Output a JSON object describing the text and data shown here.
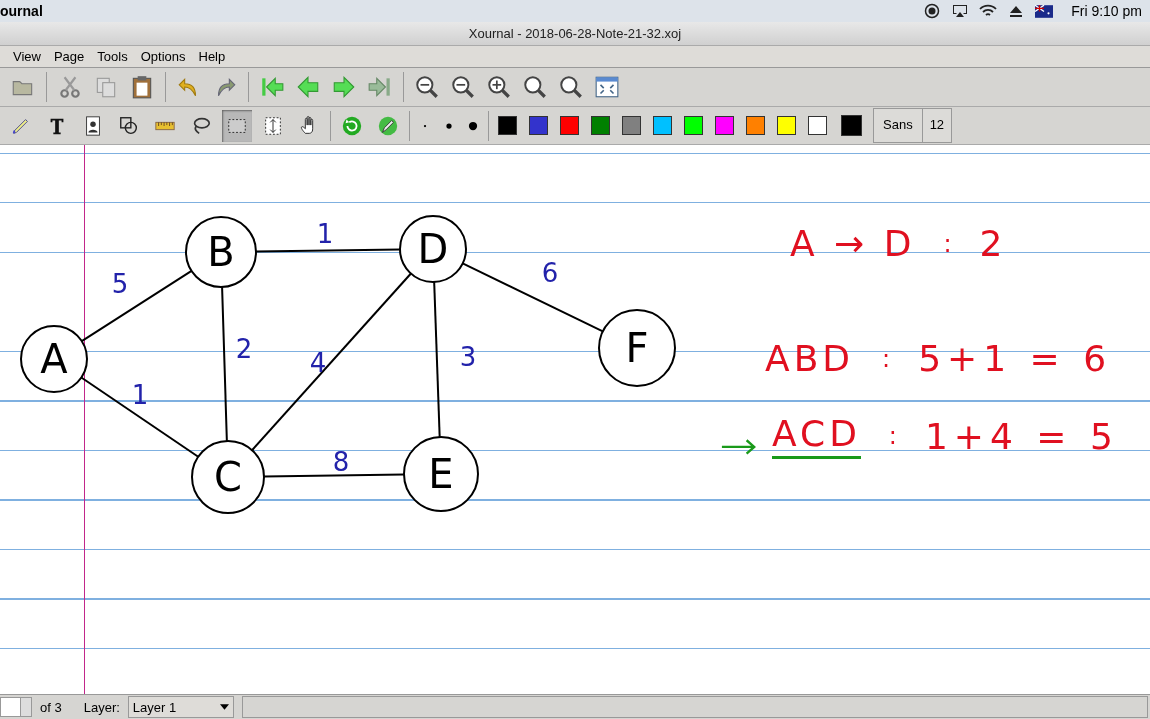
{
  "system_bar": {
    "app_name": "ournal",
    "clock": "Fri 9:10 pm"
  },
  "window": {
    "title": "Xournal - 2018-06-28-Note-21-32.xoj"
  },
  "menu": [
    "View",
    "Page",
    "Tools",
    "Options",
    "Help"
  ],
  "tools": [
    {
      "kind": "pen",
      "selected": false
    },
    {
      "kind": "text",
      "selected": false
    },
    {
      "kind": "image",
      "selected": false
    },
    {
      "kind": "shape",
      "selected": false
    },
    {
      "kind": "ruler",
      "selected": false
    },
    {
      "kind": "lasso",
      "selected": false
    },
    {
      "kind": "rect-select",
      "selected": true
    },
    {
      "kind": "vspace",
      "selected": false
    },
    {
      "kind": "hand",
      "selected": false
    },
    {
      "kind": "refresh",
      "selected": false
    },
    {
      "kind": "pencil",
      "selected": false
    }
  ],
  "colors": [
    {
      "color": "#000000"
    },
    {
      "color": "#3333cc"
    },
    {
      "color": "#ff0000"
    },
    {
      "color": "#008000"
    },
    {
      "color": "#808080"
    },
    {
      "color": "#00c0ff"
    },
    {
      "color": "#00ff00"
    },
    {
      "color": "#ff00ff"
    },
    {
      "color": "#ff8000"
    },
    {
      "color": "#ffff00"
    },
    {
      "color": "#ffffff"
    }
  ],
  "current_color": {
    "color": "#000000"
  },
  "font": {
    "name": "Sans",
    "size": "12"
  },
  "graph": {
    "nodes": [
      "A",
      "B",
      "C",
      "D",
      "E",
      "F"
    ],
    "edges": [
      {
        "weight": "5"
      },
      {
        "weight": "1"
      },
      {
        "weight": "1"
      },
      {
        "weight": "2"
      },
      {
        "weight": "4"
      },
      {
        "weight": "8"
      },
      {
        "weight": "3"
      },
      {
        "weight": "6"
      }
    ]
  },
  "notes": [
    {
      "path": "A → D",
      "sep": ":",
      "value": "2",
      "marked": false
    },
    {
      "path": "ABD",
      "sep": ":",
      "value": "5+1 = 6",
      "marked": false
    },
    {
      "path": "ACD",
      "sep": ":",
      "value": "1+4 = 5",
      "marked": true
    }
  ],
  "status_bar": {
    "page_total": "of 3",
    "layer_label": "Layer:",
    "layer": "Layer 1"
  }
}
